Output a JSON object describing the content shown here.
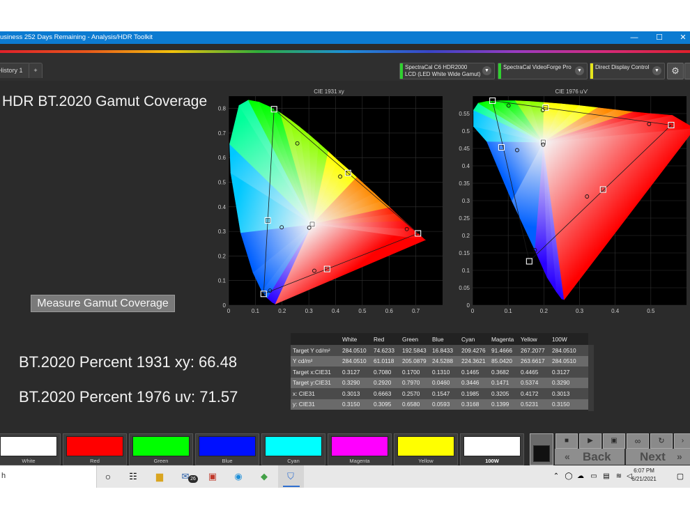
{
  "window": {
    "title": "usiness 252 Days Remaining  - Analysis/HDR Toolkit",
    "minimize_glyph": "—",
    "maximize_glyph": "☐",
    "close_glyph": "✕"
  },
  "tabs": {
    "history_label": "History 1",
    "add_glyph": "+"
  },
  "devices": [
    {
      "line1": "SpectraCal C6 HDR2000",
      "line2": "LCD (LED White Wide Gamut)",
      "color": "#2fd22f"
    },
    {
      "line1": "SpectraCal VideoForge Pro",
      "line2": "",
      "color": "#2fd22f"
    },
    {
      "line1": "Direct Display Control",
      "line2": "",
      "color": "#e6e61a"
    }
  ],
  "toolbar": {
    "settings_icon": "gear-icon"
  },
  "heading": "HDR BT.2020  Gamut Coverage",
  "measure_button": "Measure Gamut Coverage",
  "results": {
    "xy_label": "BT.2020 Percent 1931 xy: 66.48",
    "uv_label": "BT.2020 Percent 1976 uv: 71.57"
  },
  "charts": {
    "cie1931": {
      "title": "CIE 1931 xy",
      "x_ticks": [
        "0",
        "0.1",
        "0.2",
        "0.3",
        "0.4",
        "0.5",
        "0.6",
        "0.7"
      ],
      "y_ticks": [
        "0",
        "0.1",
        "0.2",
        "0.3",
        "0.4",
        "0.5",
        "0.6",
        "0.7",
        "0.8"
      ],
      "xlim": [
        0,
        0.8
      ],
      "ylim": [
        0,
        0.85
      ],
      "targets": [
        [
          0.708,
          0.292
        ],
        [
          0.17,
          0.797
        ],
        [
          0.131,
          0.046
        ],
        [
          0.3127,
          0.329
        ],
        [
          0.3682,
          0.1471
        ],
        [
          0.4465,
          0.5374
        ],
        [
          0.1465,
          0.3446
        ]
      ],
      "measured": [
        [
          0.6663,
          0.3095
        ],
        [
          0.257,
          0.658
        ],
        [
          0.1547,
          0.0593
        ],
        [
          0.3013,
          0.315
        ],
        [
          0.3205,
          0.1399
        ],
        [
          0.4172,
          0.5231
        ],
        [
          0.1985,
          0.3168
        ]
      ]
    },
    "cie1976": {
      "title": "CIE 1976 u'v'",
      "x_ticks": [
        "0",
        "0.1",
        "0.2",
        "0.3",
        "0.4",
        "0.5"
      ],
      "y_ticks": [
        "0",
        "0.05",
        "0.1",
        "0.15",
        "0.2",
        "0.25",
        "0.3",
        "0.35",
        "0.4",
        "0.45",
        "0.5",
        "0.55"
      ],
      "xlim": [
        0,
        0.6
      ],
      "ylim": [
        0,
        0.6
      ],
      "targets": [
        [
          0.557,
          0.517
        ],
        [
          0.056,
          0.587
        ],
        [
          0.159,
          0.126
        ],
        [
          0.198,
          0.468
        ],
        [
          0.366,
          0.332
        ],
        [
          0.205,
          0.567
        ],
        [
          0.081,
          0.453
        ]
      ],
      "measured": [
        [
          0.495,
          0.52
        ],
        [
          0.101,
          0.573
        ],
        [
          0.175,
          0.158
        ],
        [
          0.198,
          0.461
        ],
        [
          0.321,
          0.312
        ],
        [
          0.197,
          0.56
        ],
        [
          0.125,
          0.445
        ]
      ]
    }
  },
  "table": {
    "headers": [
      "",
      "White",
      "Red",
      "Green",
      "Blue",
      "Cyan",
      "Magenta",
      "Yellow",
      "100W"
    ],
    "rows": [
      [
        "Target Y cd/m²",
        "284.0510",
        "74.6233",
        "192.5843",
        "16.8433",
        "209.4276",
        "91.4666",
        "267.2077",
        "284.0510"
      ],
      [
        "Y cd/m²",
        "284.0510",
        "61.0118",
        "205.0879",
        "24.5288",
        "224.3621",
        "85.0420",
        "263.6617",
        "284.0510"
      ],
      [
        "Target x:CIE31",
        "0.3127",
        "0.7080",
        "0.1700",
        "0.1310",
        "0.1465",
        "0.3682",
        "0.4465",
        "0.3127"
      ],
      [
        "Target y:CIE31",
        "0.3290",
        "0.2920",
        "0.7970",
        "0.0460",
        "0.3446",
        "0.1471",
        "0.5374",
        "0.3290"
      ],
      [
        "x: CIE31",
        "0.3013",
        "0.6663",
        "0.2570",
        "0.1547",
        "0.1985",
        "0.3205",
        "0.4172",
        "0.3013"
      ],
      [
        "y: CIE31",
        "0.3150",
        "0.3095",
        "0.6580",
        "0.0593",
        "0.3168",
        "0.1399",
        "0.5231",
        "0.3150"
      ]
    ]
  },
  "swatches": [
    {
      "label": "White",
      "color": "#ffffff"
    },
    {
      "label": "Red",
      "color": "#ff0000"
    },
    {
      "label": "Green",
      "color": "#00ff00"
    },
    {
      "label": "Blue",
      "color": "#0010ff"
    },
    {
      "label": "Cyan",
      "color": "#00ffff"
    },
    {
      "label": "Magenta",
      "color": "#ff00ff"
    },
    {
      "label": "Yellow",
      "color": "#ffff00"
    },
    {
      "label": "100W",
      "color": "#ffffff"
    }
  ],
  "navigation": {
    "back_label": "Back",
    "next_label": "Next"
  },
  "taskbar": {
    "search_text": "h",
    "mail_badge": "26",
    "time": "6:07 PM",
    "date": "6/21/2021"
  }
}
